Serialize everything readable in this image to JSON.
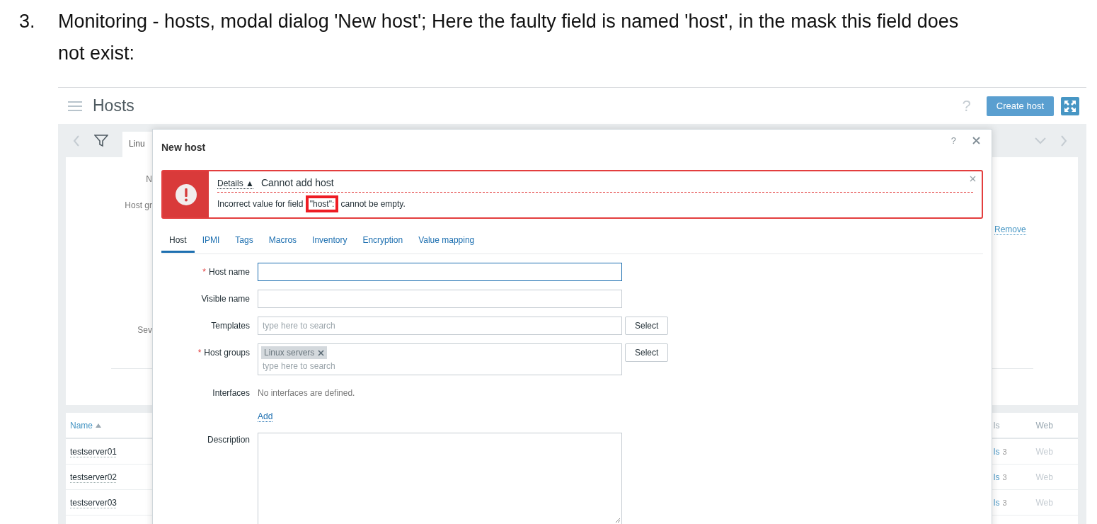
{
  "document": {
    "number": "3.",
    "text": "Monitoring - hosts, modal dialog 'New host'; Here the faulty field is named 'host', in the mask this field does not exist:"
  },
  "page": {
    "title": "Hosts",
    "help": "?",
    "create_button": "Create host",
    "filter": {
      "tab": "Linu",
      "labels": [
        "N",
        "Host gr",
        "Sev"
      ],
      "remove_link": "Remove"
    },
    "table": {
      "columns": [
        {
          "label": "Name",
          "sorted_ascending": true
        },
        {
          "label": "ls"
        },
        {
          "label": "Web"
        }
      ],
      "rows": [
        {
          "name": "testserver01",
          "link": "ls",
          "count": "3",
          "web": "Web"
        },
        {
          "name": "testserver02",
          "link": "ls",
          "count": "3",
          "web": "Web"
        },
        {
          "name": "testserver03",
          "link": "ls",
          "count": "3",
          "web": "Web"
        }
      ]
    }
  },
  "dialog": {
    "title": "New host",
    "help": "?",
    "required_marker": "*",
    "error": {
      "details": "Details ▲",
      "title": "Cannot add host",
      "message_parts": [
        {
          "text": "Incorrect value for field ",
          "highlighted": false
        },
        {
          "text": "\"host\":",
          "highlighted": true
        },
        {
          "text": " cannot be empty.",
          "highlighted": false
        }
      ]
    },
    "tabs": [
      {
        "label": "Host",
        "selected": true
      },
      {
        "label": "IPMI",
        "selected": false
      },
      {
        "label": "Tags",
        "selected": false
      },
      {
        "label": "Macros",
        "selected": false
      },
      {
        "label": "Inventory",
        "selected": false
      },
      {
        "label": "Encryption",
        "selected": false
      },
      {
        "label": "Value mapping",
        "selected": false
      }
    ],
    "fields": [
      {
        "kind": "text",
        "label": "Host name",
        "required": true,
        "focused": true
      },
      {
        "kind": "text",
        "label": "Visible name",
        "required": false,
        "focused": false
      },
      {
        "kind": "multiselect",
        "label": "Templates",
        "required": false,
        "placeholder": "type here to search",
        "button": "Select"
      },
      {
        "kind": "multiselect",
        "label": "Host groups",
        "required": true,
        "chips": [
          "Linux servers"
        ],
        "placeholder": "type here to search",
        "button": "Select"
      },
      {
        "kind": "interfaces",
        "label": "Interfaces",
        "required": false,
        "text": "No interfaces are defined.",
        "link": "Add"
      },
      {
        "kind": "textarea",
        "label": "Description",
        "required": false
      }
    ]
  }
}
